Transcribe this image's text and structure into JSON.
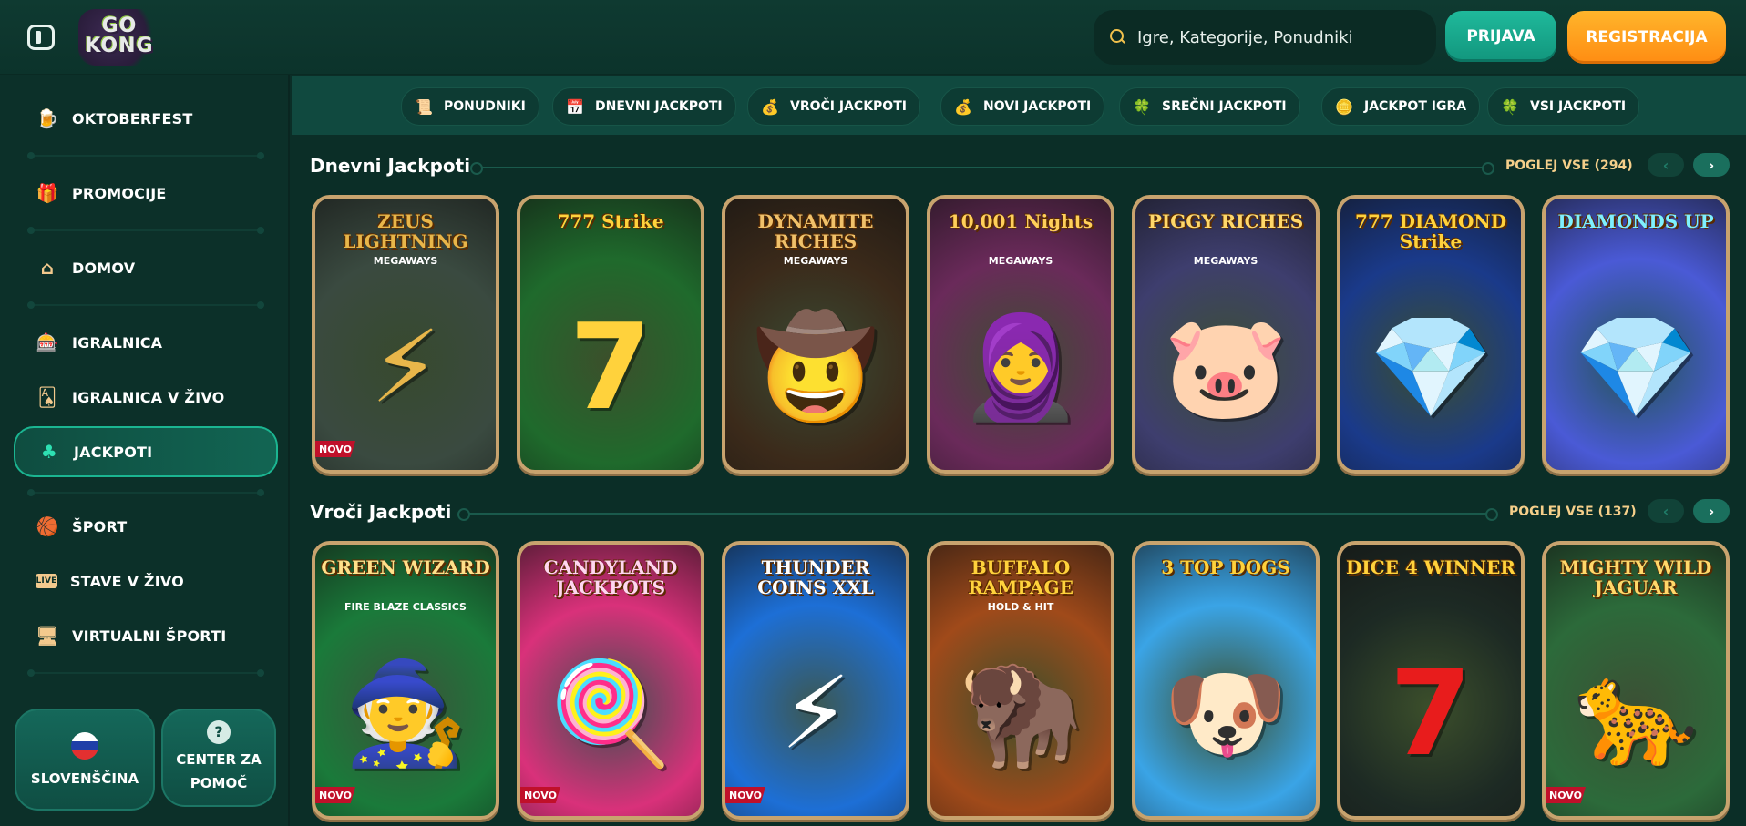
{
  "header": {
    "logo_text": "GO KONG",
    "search_placeholder": "Igre, Kategorije, Ponudniki",
    "login_label": "PRIJAVA",
    "register_label": "REGISTRACIJA"
  },
  "sidebar": {
    "items": [
      {
        "label": "OKTOBERFEST",
        "icon": "beer-mug-icon"
      },
      {
        "label": "PROMOCIJE",
        "icon": "gift-icon"
      },
      {
        "label": "DOMOV",
        "icon": "home-icon"
      },
      {
        "label": "IGRALNICA",
        "icon": "slot-machine-icon"
      },
      {
        "label": "IGRALNICA V ŽIVO",
        "icon": "playing-card-icon"
      },
      {
        "label": "JACKPOTI",
        "icon": "clover-icon"
      },
      {
        "label": "ŠPORT",
        "icon": "basketball-icon"
      },
      {
        "label": "STAVE V ŽIVO",
        "icon": "live-icon"
      },
      {
        "label": "VIRTUALNI ŠPORTI",
        "icon": "virtual-sports-icon"
      }
    ],
    "live_badge": "LIVE",
    "language_label": "SLOVENŠČINA",
    "help_label_line1": "CENTER ZA",
    "help_label_line2": "POMOČ",
    "help_icon_glyph": "?"
  },
  "categories": [
    {
      "label": "PONUDNIKI",
      "icon": "scroll-icon",
      "glyph": "📜"
    },
    {
      "label": "DNEVNI JACKPOTI",
      "icon": "calendar-icon",
      "glyph": "📅"
    },
    {
      "label": "VROČI JACKPOTI",
      "icon": "hot-pot-icon",
      "glyph": "💰"
    },
    {
      "label": "NOVI JACKPOTI",
      "icon": "money-bag-icon",
      "glyph": "💰"
    },
    {
      "label": "SREČNI JACKPOTI",
      "icon": "clover-icon",
      "glyph": "🍀"
    },
    {
      "label": "JACKPOT IGRA",
      "icon": "coin-icon",
      "glyph": "🪙"
    },
    {
      "label": "VSI JACKPOTI",
      "icon": "clover-coin-icon",
      "glyph": "🍀"
    }
  ],
  "sections": [
    {
      "title": "Dnevni Jackpoti",
      "view_all": "POGLEJ VSE (294)",
      "games": [
        {
          "title": "ZEUS LIGHTNING",
          "sub": "MEGAWAYS",
          "badge": "NOVO",
          "bg": "#3a4a40",
          "accent": "#e8b64a",
          "art": "⚡"
        },
        {
          "title": "777 Strike",
          "sub": "",
          "badge": "",
          "bg": "#1f6a2c",
          "accent": "#ffd23c",
          "art": "7"
        },
        {
          "title": "DYNAMITE RICHES",
          "sub": "MEGAWAYS",
          "badge": "",
          "bg": "#3b2a1a",
          "accent": "#f0c16a",
          "art": "🤠"
        },
        {
          "title": "10,001 Nights",
          "sub": "MEGAWAYS",
          "badge": "",
          "bg": "#6a2a5a",
          "accent": "#ffcf5a",
          "art": "🧕"
        },
        {
          "title": "PIGGY RICHES",
          "sub": "MEGAWAYS",
          "badge": "",
          "bg": "#3e3e6e",
          "accent": "#ffd86a",
          "art": "🐷"
        },
        {
          "title": "777 DIAMOND Strike",
          "sub": "",
          "badge": "",
          "bg": "#1a3a8a",
          "accent": "#ffd23c",
          "art": "💎"
        },
        {
          "title": "DIAMONDS UP",
          "sub": "",
          "badge": "",
          "bg": "#4a5ad6",
          "accent": "#7ef0ff",
          "art": "💎"
        }
      ]
    },
    {
      "title": "Vroči Jackpoti",
      "view_all": "POGLEJ VSE (137)",
      "games": [
        {
          "title": "GREEN WIZARD",
          "sub": "FIRE BLAZE CLASSICS",
          "badge": "NOVO",
          "bg": "#1a7a3a",
          "accent": "#ffe08a",
          "art": "🧙"
        },
        {
          "title": "CANDYLAND JACKPOTS",
          "sub": "",
          "badge": "NOVO",
          "bg": "#d9317a",
          "accent": "#ffd6f0",
          "art": "🍭"
        },
        {
          "title": "THUNDER COINS XXL",
          "sub": "",
          "badge": "NOVO",
          "bg": "#1d6fd6",
          "accent": "#ffffff",
          "art": "⚡"
        },
        {
          "title": "BUFFALO RAMPAGE",
          "sub": "HOLD & HIT",
          "badge": "",
          "bg": "#a04a1a",
          "accent": "#ffd23c",
          "art": "🦬"
        },
        {
          "title": "3 TOP DOGS",
          "sub": "",
          "badge": "",
          "bg": "#3aa4e6",
          "accent": "#ffd23c",
          "art": "🐶"
        },
        {
          "title": "DICE 4 WINNER",
          "sub": "",
          "badge": "",
          "bg": "#1d2a24",
          "accent": "#ffd23c",
          "art": "7"
        },
        {
          "title": "MIGHTY WILD JAGUAR",
          "sub": "",
          "badge": "NOVO",
          "bg": "#2c6a3a",
          "accent": "#ffd86a",
          "art": "🐆"
        }
      ]
    }
  ]
}
